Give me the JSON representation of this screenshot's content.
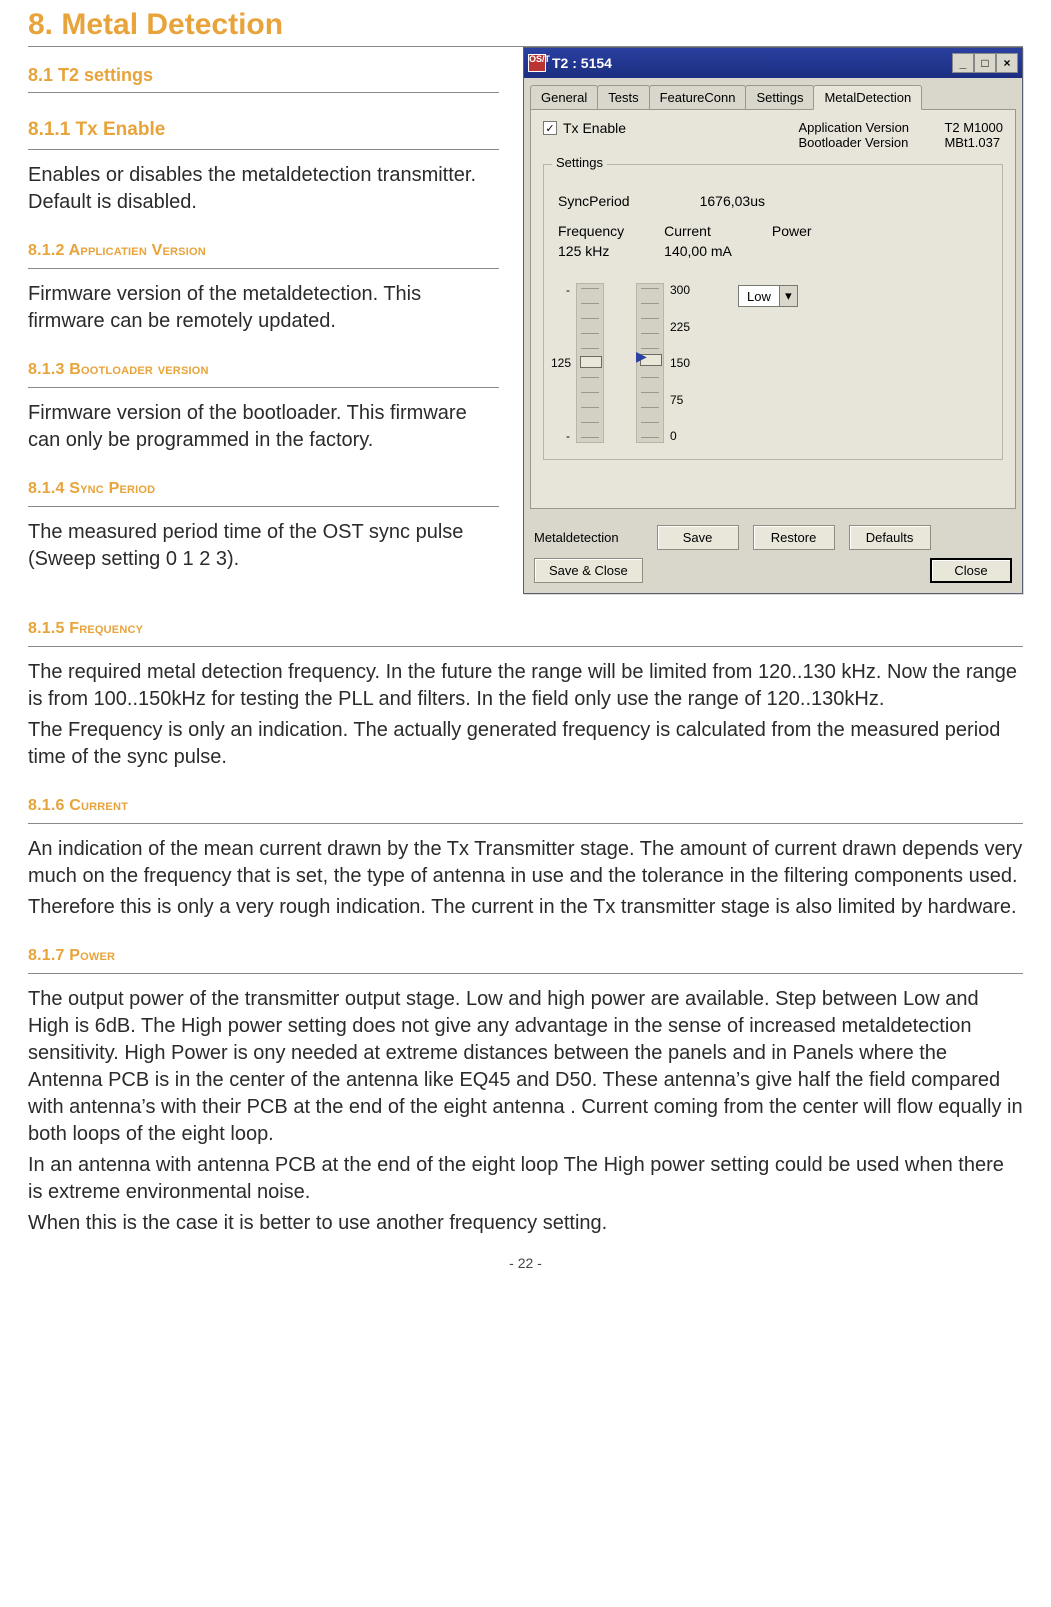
{
  "page": {
    "title": "8. Metal Detection",
    "footer_left": "- ",
    "footer_page": "22",
    "footer_right": " -"
  },
  "sections": {
    "s81": {
      "heading": "8.1 T2 settings"
    },
    "s811": {
      "heading": "8.1.1 Tx Enable",
      "body": "Enables or disables the metaldetection transmitter. Default is disabled."
    },
    "s812": {
      "lead": "8.1.2 A",
      "rest": "pplicatien Version",
      "body": "Firmware version of the metaldetection. This firmware can be remotely updated."
    },
    "s813": {
      "lead": "8.1.3 B",
      "rest": "ootloader version",
      "body": "Firmware version of the bootloader. This firmware can only be programmed in the factory."
    },
    "s814": {
      "lead": "8.1.4 S",
      "rest": "ync Period",
      "body": "The measured period time of the OST sync pulse (Sweep setting 0 1 2 3)."
    },
    "s815": {
      "lead": "8.1.5 F",
      "rest": "requency",
      "body1": "The required metal detection frequency. In the future the range will be limited from 120..130 kHz. Now the range is from 100..150kHz for testing the PLL and filters. In the field only use the range of 120..130kHz.",
      "body2": "The Frequency is only an indication. The actually generated frequency is calculated from the measured period time of the sync pulse."
    },
    "s816": {
      "lead": "8.1.6 C",
      "rest": "urrent",
      "body1": "An indication of the mean current drawn by the Tx Transmitter stage. The amount of current drawn depends very much on the frequency that is set, the type of antenna in use and the tolerance in the filtering components used.",
      "body2": "Therefore this is only a very rough indication. The current in the Tx transmitter stage is also limited by hardware."
    },
    "s817": {
      "lead": "8.1.7 P",
      "rest": "ower",
      "body1": "The output power of the transmitter output stage. Low and high power are available. Step between Low and High is 6dB. The High power setting does not give any advantage in the sense of increased metaldetection sensitivity. High Power is ony needed at extreme distances between the panels and in Panels where the Antenna PCB is in the center of the antenna like EQ45 and D50. These antenna’s give half the field compared with antenna’s with their PCB at the end of the eight antenna . Current coming from the center will flow equally in both loops of the eight loop.",
      "body2": "In an antenna with antenna PCB at the end of the eight loop The High power setting could be used when there is extreme environmental noise.",
      "body3": "When this is the case it is better to use another frequency setting."
    }
  },
  "dialog": {
    "title": "T2 : 5154",
    "icon": "OS/T",
    "controls": {
      "min": "_",
      "max": "□",
      "close": "×"
    },
    "tabs": [
      "General",
      "Tests",
      "FeatureConn",
      "Settings",
      "MetalDetection"
    ],
    "tx_enable_label": "Tx Enable",
    "tx_enable_checked": "✓",
    "versions": {
      "app_label": "Application Version",
      "app_value": "T2 M1000",
      "boot_label": "Bootloader Version",
      "boot_value": "MBt1.037"
    },
    "settings_legend": "Settings",
    "sync": {
      "label": "SyncPeriod",
      "value": "1676,03us"
    },
    "freq": {
      "label": "Frequency",
      "value": "125 kHz"
    },
    "curr": {
      "label": "Current",
      "value": "140,00 mA"
    },
    "power_label": "Power",
    "power_value": "Low",
    "slider1_mid": "125",
    "slider2_labels": {
      "t300": "300",
      "t225": "225",
      "t150": "150",
      "t75": "75",
      "t0": "0"
    },
    "dash": "-",
    "buttons": {
      "row_label": "Metaldetection",
      "save": "Save",
      "restore": "Restore",
      "defaults": "Defaults",
      "save_close": "Save & Close",
      "close": "Close"
    }
  }
}
